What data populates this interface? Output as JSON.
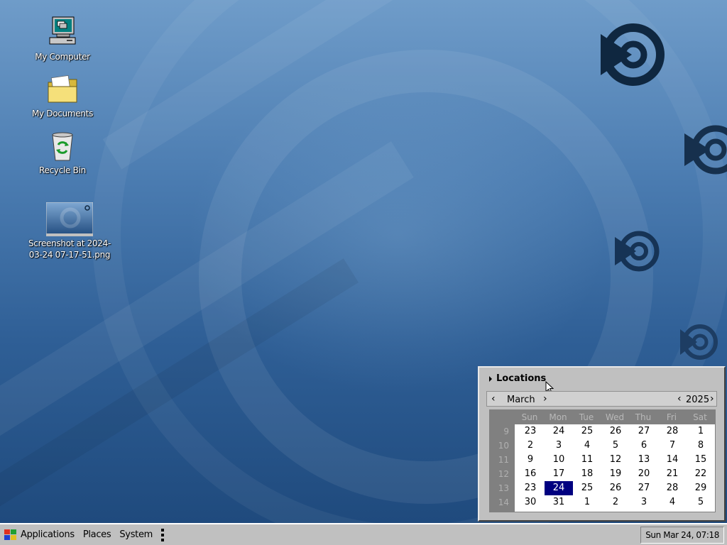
{
  "desktop": {
    "icons": [
      {
        "label": "My Computer"
      },
      {
        "label": "My Documents"
      },
      {
        "label": "Recycle Bin"
      },
      {
        "label": "Screenshot at 2024-03-24 07-17-51.png"
      }
    ]
  },
  "taskbar": {
    "applications_label": "Applications",
    "places_label": "Places",
    "system_label": "System",
    "clock": "Sun Mar 24, 07:18"
  },
  "calendar": {
    "locations_label": "Locations",
    "month": "March",
    "year": "2025",
    "day_names": [
      "Sun",
      "Mon",
      "Tue",
      "Wed",
      "Thu",
      "Fri",
      "Sat"
    ],
    "weeks": [
      {
        "num": "9",
        "days": [
          "23",
          "24",
          "25",
          "26",
          "27",
          "28",
          "1"
        ]
      },
      {
        "num": "10",
        "days": [
          "2",
          "3",
          "4",
          "5",
          "6",
          "7",
          "8"
        ]
      },
      {
        "num": "11",
        "days": [
          "9",
          "10",
          "11",
          "12",
          "13",
          "14",
          "15"
        ]
      },
      {
        "num": "12",
        "days": [
          "16",
          "17",
          "18",
          "19",
          "20",
          "21",
          "22"
        ]
      },
      {
        "num": "13",
        "days": [
          "23",
          "24",
          "25",
          "26",
          "27",
          "28",
          "29"
        ]
      },
      {
        "num": "14",
        "days": [
          "30",
          "31",
          "1",
          "2",
          "3",
          "4",
          "5"
        ]
      }
    ],
    "selected_day": "24"
  },
  "colors": {
    "selection": "#000080",
    "taskbar": "#c0c0c0",
    "desktop": "#2f5f96"
  },
  "icons": [
    "computer-icon",
    "folder-icon",
    "recycle-bin-icon",
    "image-thumbnail-icon",
    "distro-logo-icon",
    "windows-logo-icon",
    "mouse-cursor-icon"
  ]
}
